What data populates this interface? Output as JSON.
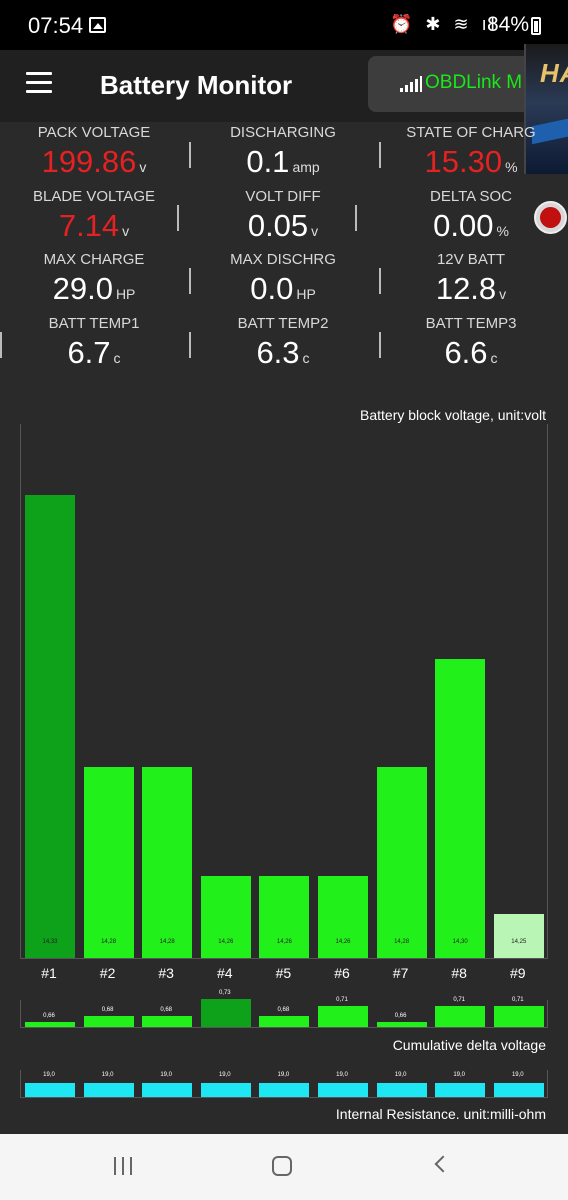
{
  "status_bar": {
    "time": "07:54",
    "icons": "⏰ ✱ ≋ ıl",
    "battery_percent": "84%",
    "gallery_icon": "image-icon"
  },
  "app_bar": {
    "title": "Battery Monitor",
    "connection_label": "OBDLink M",
    "menu_icon": "hamburger-menu-icon",
    "signal_icon": "signal-bars-icon"
  },
  "overlay": {
    "ad_text": "HA",
    "record_icon": "record-icon"
  },
  "metrics": [
    {
      "label": "PACK VOLTAGE",
      "value": "199.86",
      "unit": "v",
      "color": "#e52121"
    },
    {
      "label": "DISCHARGING",
      "value": "0.1",
      "unit": "amp",
      "color": "#ffffff"
    },
    {
      "label": "STATE OF CHARG",
      "value": "15.30",
      "unit": "%",
      "color": "#e52121"
    },
    {
      "label": "BLADE VOLTAGE",
      "value": "7.14",
      "unit": "v",
      "color": "#e52121"
    },
    {
      "label": "VOLT DIFF",
      "value": "0.05",
      "unit": "v",
      "color": "#ffffff"
    },
    {
      "label": "DELTA SOC",
      "value": "0.00",
      "unit": "%",
      "color": "#ffffff"
    },
    {
      "label": "MAX CHARGE",
      "value": "29.0",
      "unit": "HP",
      "color": "#ffffff"
    },
    {
      "label": "MAX DISCHRG",
      "value": "0.0",
      "unit": "HP",
      "color": "#ffffff"
    },
    {
      "label": "12V BATT",
      "value": "12.8",
      "unit": "v",
      "color": "#ffffff"
    },
    {
      "label": "BATT TEMP1",
      "value": "6.7",
      "unit": "c",
      "color": "#ffffff"
    },
    {
      "label": "BATT TEMP2",
      "value": "6.3",
      "unit": "c",
      "color": "#ffffff"
    },
    {
      "label": "BATT TEMP3",
      "value": "6.6",
      "unit": "c",
      "color": "#ffffff"
    }
  ],
  "chart_data": [
    {
      "type": "bar",
      "title": "Battery block voltage, unit:volt",
      "categories": [
        "#1",
        "#2",
        "#3",
        "#4",
        "#5",
        "#6",
        "#7",
        "#8",
        "#9"
      ],
      "values": [
        14.33,
        14.28,
        14.28,
        14.26,
        14.26,
        14.26,
        14.28,
        14.3,
        14.25
      ],
      "value_labels": [
        "14,33",
        "14,28",
        "14,28",
        "14,26",
        "14,26",
        "14,26",
        "14,28",
        "14,30",
        "14,25"
      ],
      "ylim": [
        14.245,
        14.335
      ],
      "colors": [
        "#0ea11a",
        "#22f01a",
        "#22f01a",
        "#22f01a",
        "#22f01a",
        "#22f01a",
        "#22f01a",
        "#22f01a",
        "#b9f5b4"
      ]
    },
    {
      "type": "bar",
      "title": "Cumulative delta voltage",
      "categories": [
        "#1",
        "#2",
        "#3",
        "#4",
        "#5",
        "#6",
        "#7",
        "#8",
        "#9"
      ],
      "values": [
        0.66,
        0.68,
        0.68,
        0.73,
        0.68,
        0.71,
        0.66,
        0.71,
        0.71
      ],
      "value_labels": [
        "0,66",
        "0,68",
        "0,68",
        "0,73",
        "0,68",
        "0,71",
        "0,66",
        "0,71",
        "0,71"
      ],
      "ylim": [
        0.655,
        0.73
      ],
      "colors": [
        "#22f01a",
        "#22f01a",
        "#22f01a",
        "#0ea11a",
        "#22f01a",
        "#22f01a",
        "#22f01a",
        "#22f01a",
        "#22f01a"
      ]
    },
    {
      "type": "bar",
      "title": "Internal Resistance. unit:milli-ohm",
      "categories": [
        "#1",
        "#2",
        "#3",
        "#4",
        "#5",
        "#6",
        "#7",
        "#8",
        "#9"
      ],
      "values": [
        19.0,
        19.0,
        19.0,
        19.0,
        19.0,
        19.0,
        19.0,
        19.0,
        19.0
      ],
      "value_labels": [
        "19,0",
        "19,0",
        "19,0",
        "19,0",
        "19,0",
        "19,0",
        "19,0",
        "19,0",
        "19,0"
      ],
      "colors": [
        "#1ee6f2"
      ]
    }
  ],
  "nav_bar": {
    "recents_icon": "recents-icon",
    "home_icon": "home-icon",
    "back_icon": "back-icon"
  }
}
